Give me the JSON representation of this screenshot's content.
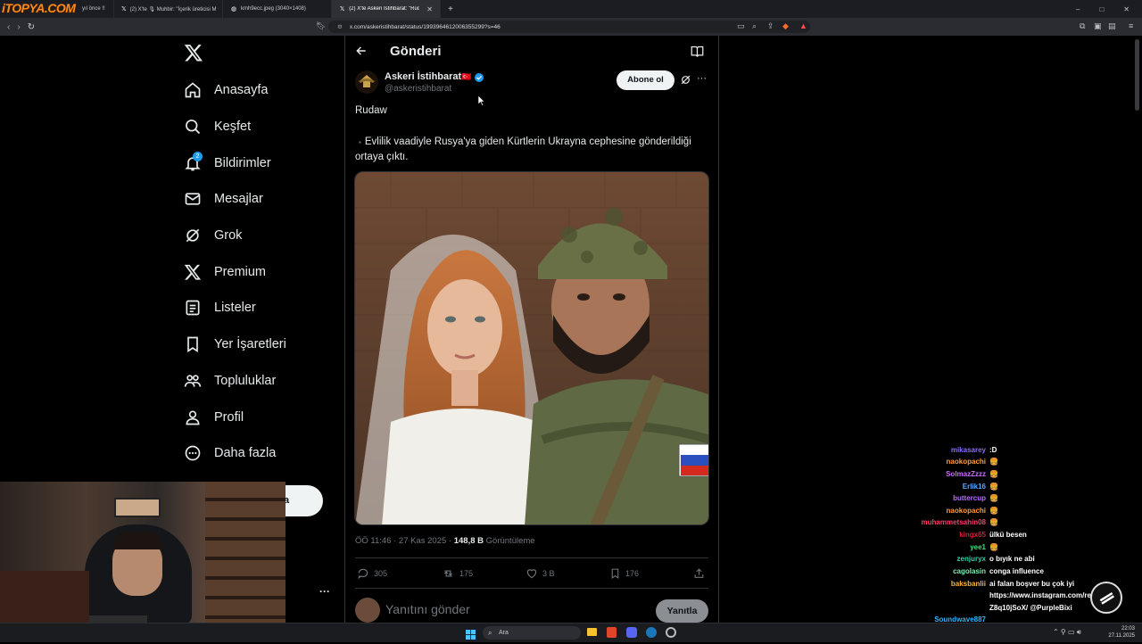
{
  "browser": {
    "logo": "iTOPYA.COM",
    "tabs": [
      {
        "title": "yıl önce !!",
        "active": false
      },
      {
        "title": "(2) X'te 🎙 Muhbir: \"İçerik üreticisi M",
        "active": false
      },
      {
        "title": "kmh9ecc.jpeg (3040×1408)",
        "active": false
      },
      {
        "title": "(2) X'te Askeri İstihbarat: \"Rud",
        "active": true
      }
    ],
    "new_tab": "+",
    "url": "x.com/askeristihbarat/status/1993964612006355299?s=46",
    "window_controls": [
      "–",
      "□",
      "✕"
    ]
  },
  "sidebar": {
    "logo": "X",
    "items": [
      {
        "label": "Anasayfa",
        "icon": "home-icon"
      },
      {
        "label": "Keşfet",
        "icon": "search-icon"
      },
      {
        "label": "Bildirimler",
        "icon": "bell-icon",
        "badge": "2"
      },
      {
        "label": "Mesajlar",
        "icon": "mail-icon"
      },
      {
        "label": "Grok",
        "icon": "grok-icon"
      },
      {
        "label": "Premium",
        "icon": "x-premium-icon"
      },
      {
        "label": "Listeler",
        "icon": "list-icon"
      },
      {
        "label": "Yer İşaretleri",
        "icon": "bookmark-icon"
      },
      {
        "label": "Topluluklar",
        "icon": "communities-icon"
      },
      {
        "label": "Profil",
        "icon": "person-icon"
      },
      {
        "label": "Daha fazla",
        "icon": "more-circle-icon"
      }
    ],
    "post_button_partial": "a",
    "more_dots": "···"
  },
  "header": {
    "title": "Gönderi"
  },
  "tweet": {
    "author_name": "Askeri İstihbarat",
    "author_flag": "🇹🇷",
    "author_handle": "@askeristihbarat",
    "subscribe_label": "Abone ol",
    "source": "Rudaw",
    "body": "Evlilik vaadiyle Rusya'ya giden Kürtlerin Ukrayna cephesine gönderildiği ortaya çıktı.",
    "bullet": "▪",
    "time": "ÖÖ 11:46 · 27 Kas 2025 · ",
    "views_count": "148,8 B",
    "views_label": " Görüntüleme",
    "replies": "305",
    "retweets": "175",
    "likes": "3 B",
    "bookmarks": "176",
    "reply_placeholder": "Yanıtını gönder",
    "reply_button": "Yanıtla"
  },
  "chat": [
    {
      "user": "mikasarey",
      "msg": ":D",
      "color": "#8a6cff"
    },
    {
      "user": "naokopachi",
      "msg": "🍔",
      "color": "#ff9a3c"
    },
    {
      "user": "SolmazZzzz",
      "msg": "🍔",
      "color": "#c86bff"
    },
    {
      "user": "Erlik16",
      "msg": "🍔",
      "color": "#5aa8ff"
    },
    {
      "user": "buttercup",
      "msg": "🍔",
      "color": "#b56cff"
    },
    {
      "user": "naokopachi",
      "msg": "🍔",
      "color": "#ff9a3c"
    },
    {
      "user": "muhammetsahin08",
      "msg": "🍔",
      "color": "#ff3b6b"
    },
    {
      "user": "kingx65",
      "msg": "ülkü besen",
      "color": "#d11f3a"
    },
    {
      "user": "yee1",
      "msg": "🍔",
      "color": "#3ee07a"
    },
    {
      "user": "zenjuryx",
      "msg": "o bıyık ne abi",
      "color": "#2fd1a6"
    },
    {
      "user": "cagolasin",
      "msg": "conga influence",
      "color": "#7cf0b0"
    },
    {
      "user": "baksbanlii",
      "msg": "ai falan boşver bu çok iyi",
      "color": "#ffb43c"
    },
    {
      "user": "",
      "msg": "https://www.instagram.com/reel/DR",
      "color": "#ffffff"
    },
    {
      "user": "",
      "msg": "Z8q10jSoX/ @PurpleBixi",
      "color": "#ffffff"
    },
    {
      "user": "Soundwave887",
      "msg": "",
      "color": "#2fb5ff"
    }
  ],
  "taskbar": {
    "search": "Ara",
    "time": "22:03",
    "date": "27.11.2025"
  }
}
